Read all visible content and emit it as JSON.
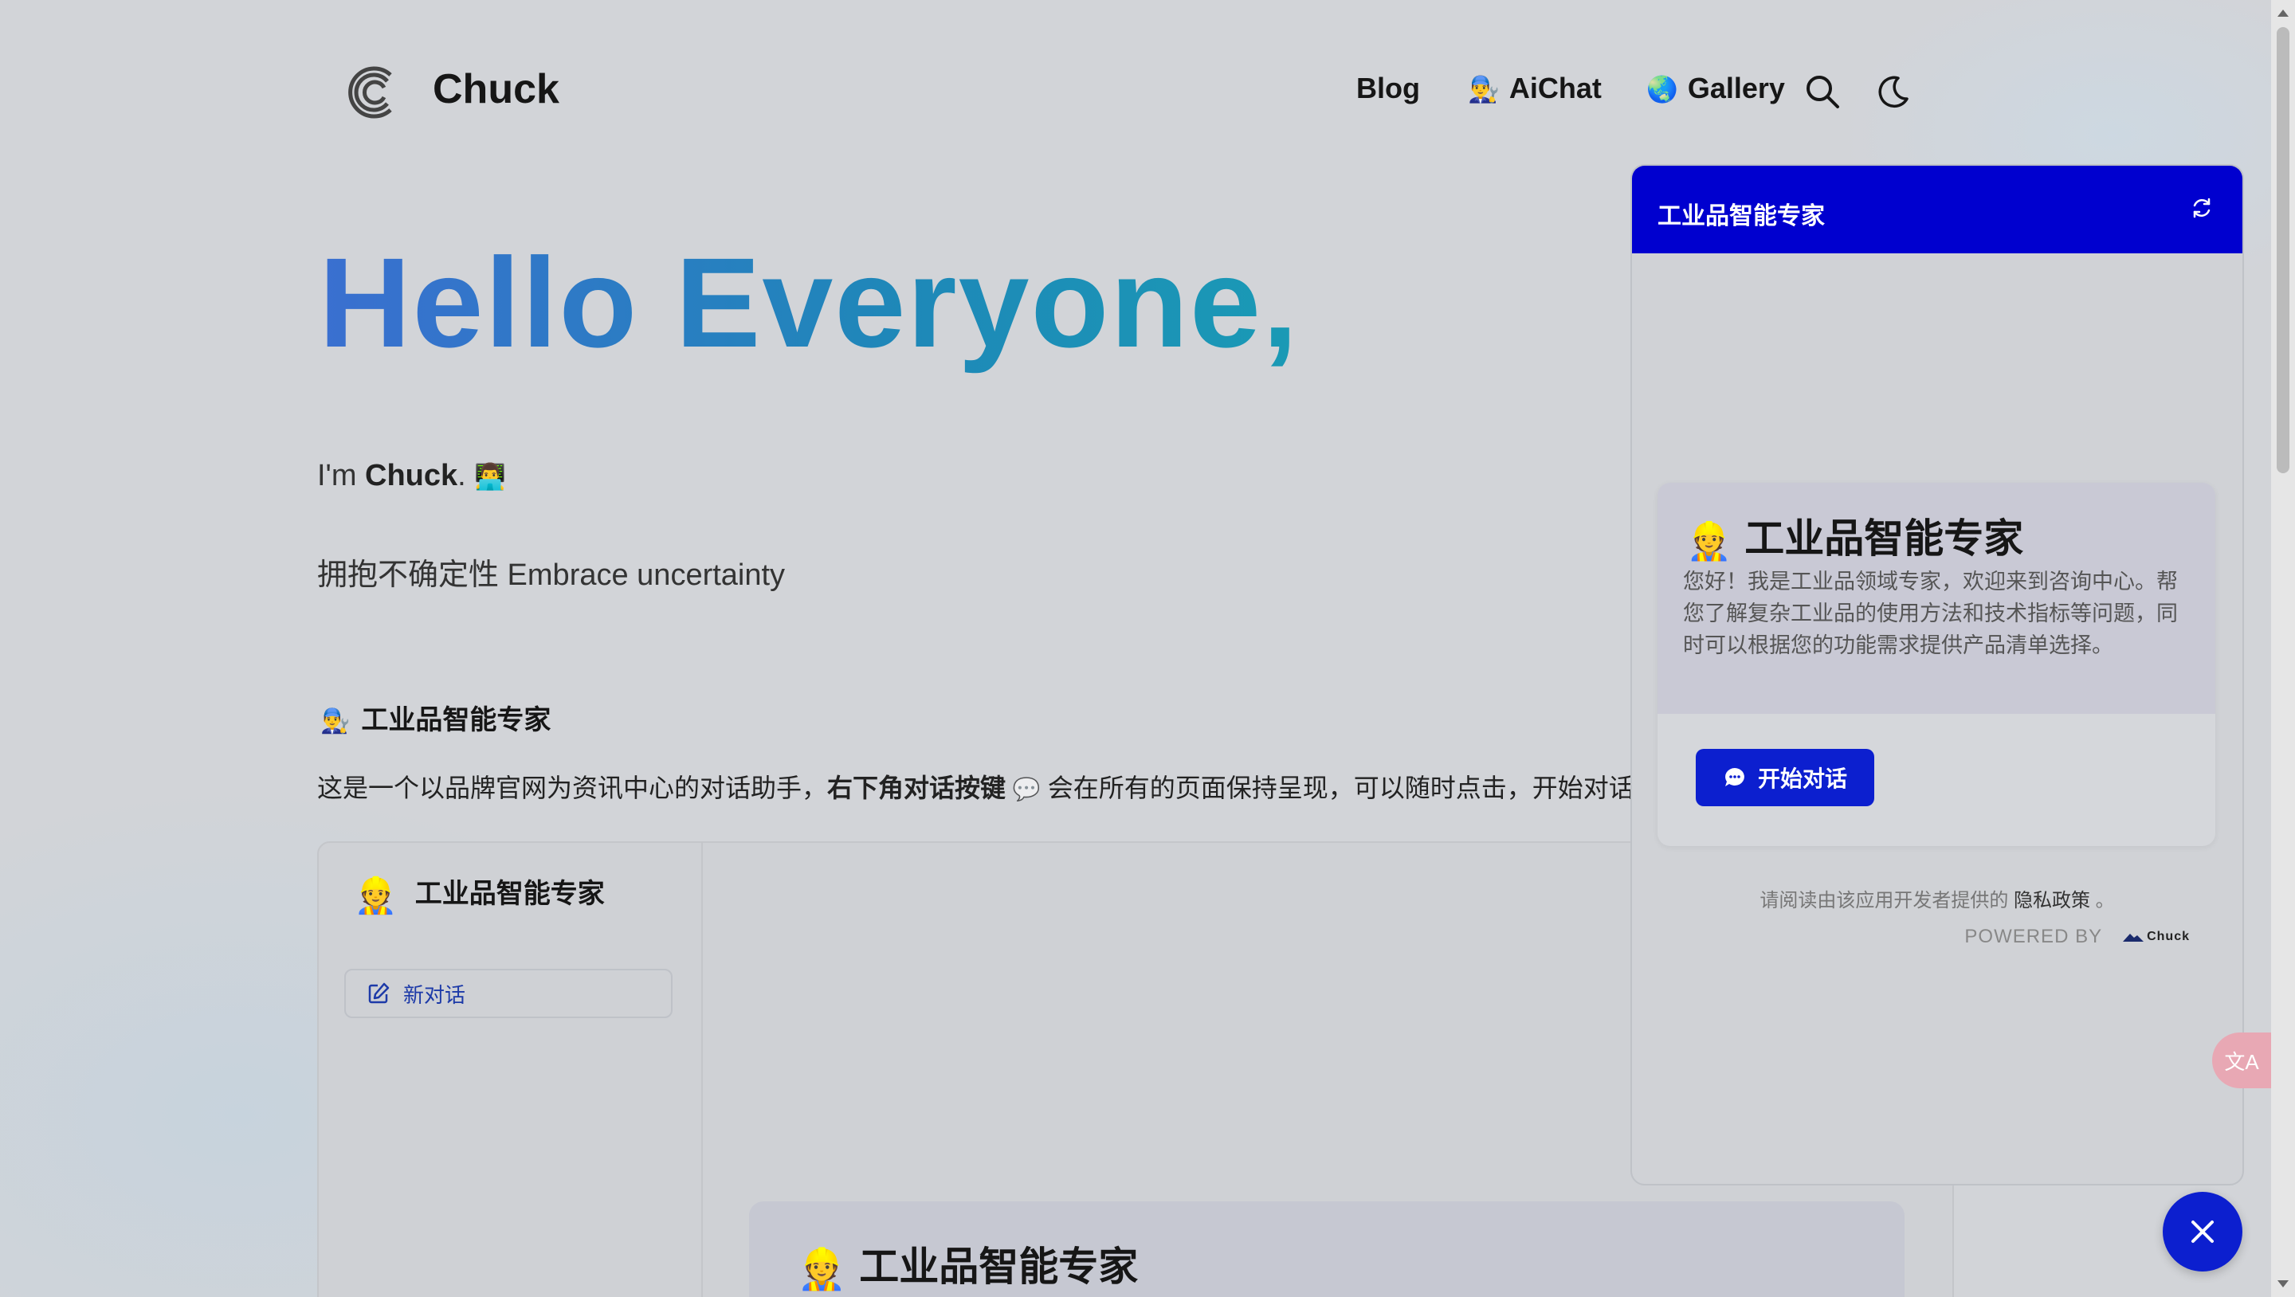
{
  "header": {
    "brand": "Chuck",
    "nav": [
      {
        "label": "Blog",
        "emoji": ""
      },
      {
        "label": "AiChat",
        "emoji": "👨‍🔧"
      },
      {
        "label": "Gallery",
        "emoji": "🌏"
      }
    ]
  },
  "hero": {
    "greeting": "Hello Everyone,",
    "intro_prefix": "I'm ",
    "intro_name": "Chuck",
    "intro_suffix": ". ",
    "intro_emoji": "👨‍💻",
    "tagline": "拥抱不确定性 Embrace uncertainty"
  },
  "section": {
    "emoji": "👨‍🔧",
    "title": "工业品智能专家",
    "desc_prefix": "这是一个以品牌官网为资讯中心的对话助手，",
    "desc_bold": "右下角对话按键",
    "desc_bubble": "💬",
    "desc_suffix": " 会在所有的页面保持呈现，可以随时点击，开始对话"
  },
  "demo": {
    "emoji": "👷",
    "title": "工业品智能专家",
    "new_chat": "新对话",
    "welcome_title": "工业品智能专家"
  },
  "chat": {
    "header_title": "工业品智能专家",
    "welcome_emoji": "👷",
    "welcome_title": "工业品智能专家",
    "welcome_text": "您好！我是工业品领域专家，欢迎来到咨询中心。帮您了解复杂工业品的使用方法和技术指标等问题，同时可以根据您的功能需求提供产品清单选择。",
    "start_button": "开始对话",
    "privacy_prefix": "请阅读由该应用开发者提供的",
    "privacy_link": "隐私政策",
    "privacy_suffix": "。",
    "powered_by": "POWERED BY",
    "powered_brand": "Chuck"
  },
  "translate_label": "文A",
  "colors": {
    "accent": "#0c1fcf",
    "chat_header": "#0000cf",
    "hero_gradient_start": "#3a6fd0",
    "hero_gradient_end": "#1a9ab5"
  }
}
